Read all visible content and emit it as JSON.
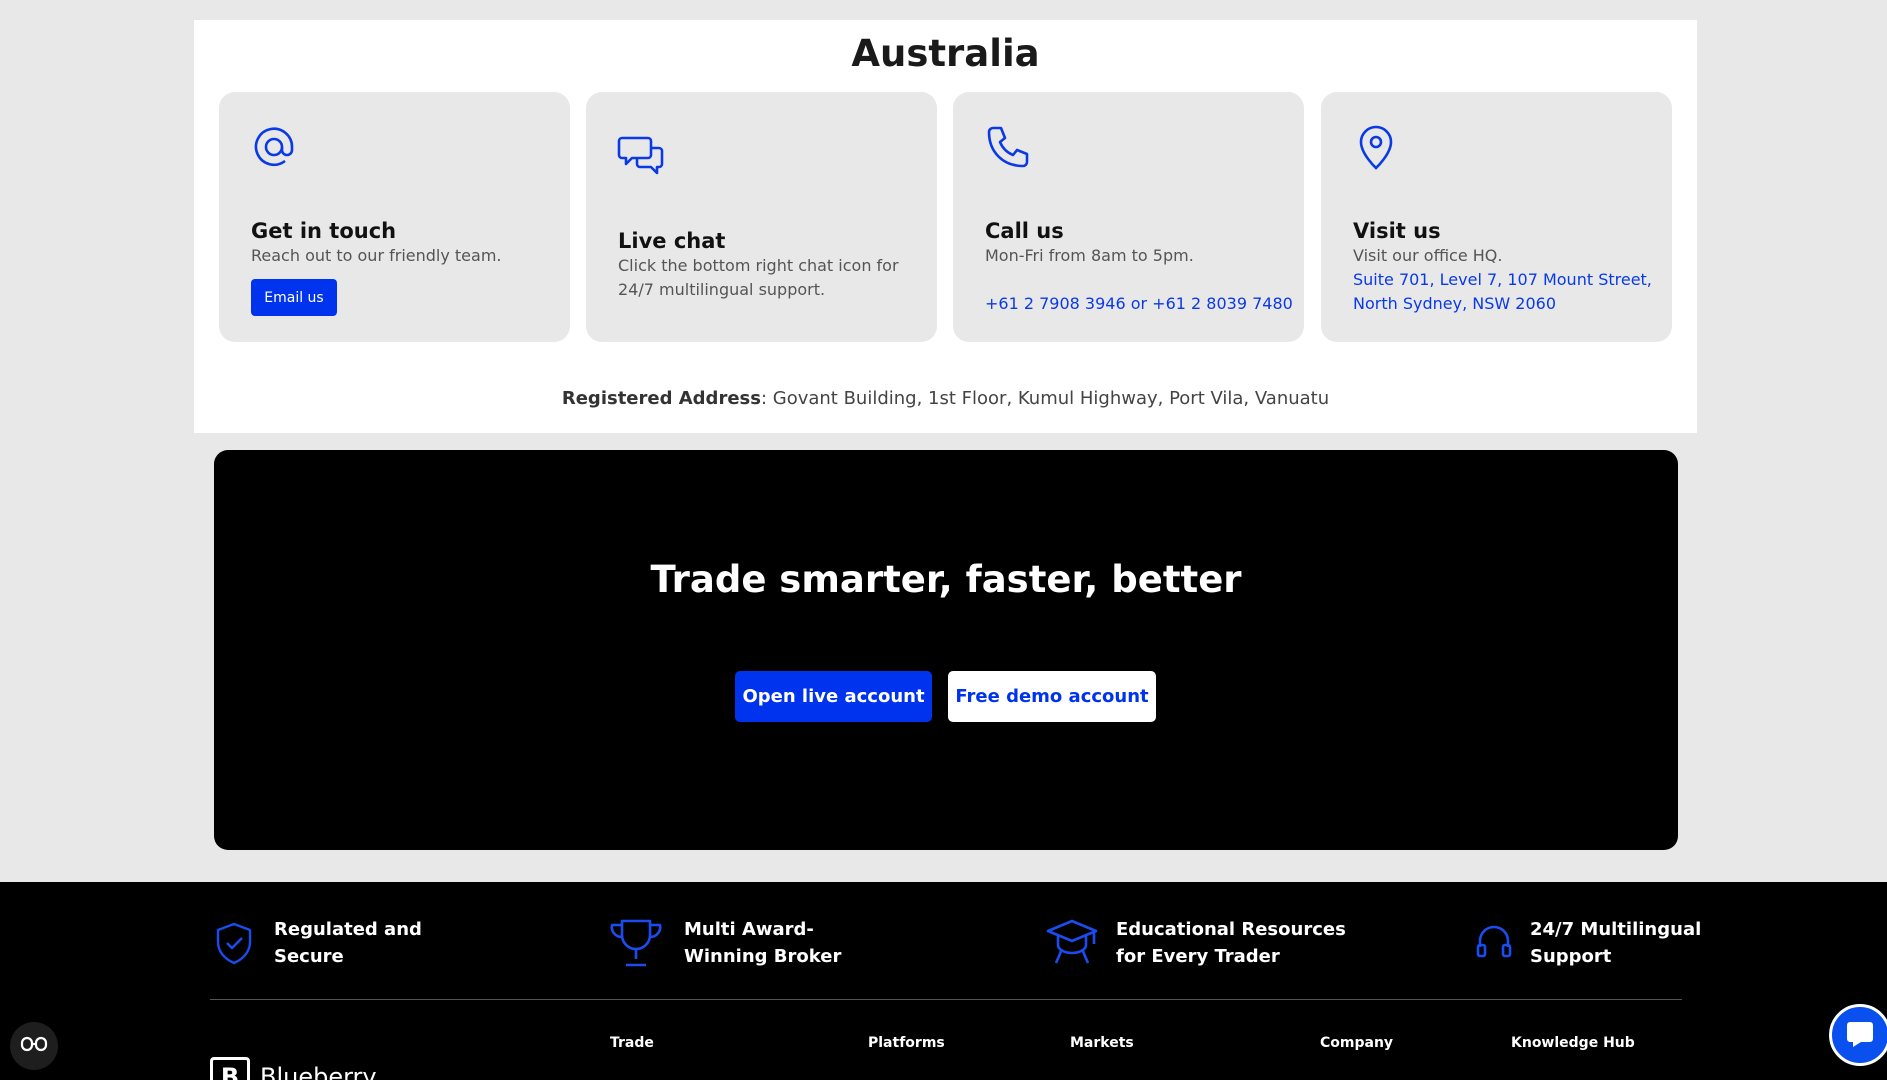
{
  "contact": {
    "region_title": "Australia",
    "cards": [
      {
        "icon": "at-sign-icon",
        "title": "Get in touch",
        "desc": "Reach out to our friendly team.",
        "button": "Email us"
      },
      {
        "icon": "chat-bubbles-icon",
        "title": "Live chat",
        "desc": "Click the bottom right chat icon for 24/7 multilingual support."
      },
      {
        "icon": "phone-icon",
        "title": "Call us",
        "desc": "Mon-Fri from 8am to 5pm.",
        "link": "+61 2 7908 3946 or +61 2 8039 7480"
      },
      {
        "icon": "location-pin-icon",
        "title": "Visit us",
        "desc": "Visit our office HQ.",
        "link": "Suite 701, Level 7, 107 Mount Street, North Sydney, NSW 2060"
      }
    ],
    "registered_label": "Registered Address",
    "registered_value": ": Govant Building, 1st Floor, Kumul Highway, Port Vila, Vanuatu"
  },
  "cta": {
    "title": "Trade smarter, faster, better",
    "live_button": "Open live account",
    "demo_button": "Free demo account"
  },
  "footer": {
    "features": [
      {
        "icon": "shield-check-icon",
        "text": "Regulated and Secure"
      },
      {
        "icon": "trophy-icon",
        "text": "Multi Award-Winning Broker"
      },
      {
        "icon": "graduation-cap-icon",
        "text": "Educational Resources for Every Trader"
      },
      {
        "icon": "headset-icon",
        "text": "24/7 Multilingual Support"
      }
    ],
    "columns": [
      "Trade",
      "Platforms",
      "Markets",
      "Company",
      "Knowledge Hub"
    ],
    "logo_text": "Blueberry"
  },
  "colors": {
    "accent": "#0033ee",
    "link": "#0a3ae6",
    "dark": "#000000",
    "card_bg": "#e8e8e8"
  }
}
